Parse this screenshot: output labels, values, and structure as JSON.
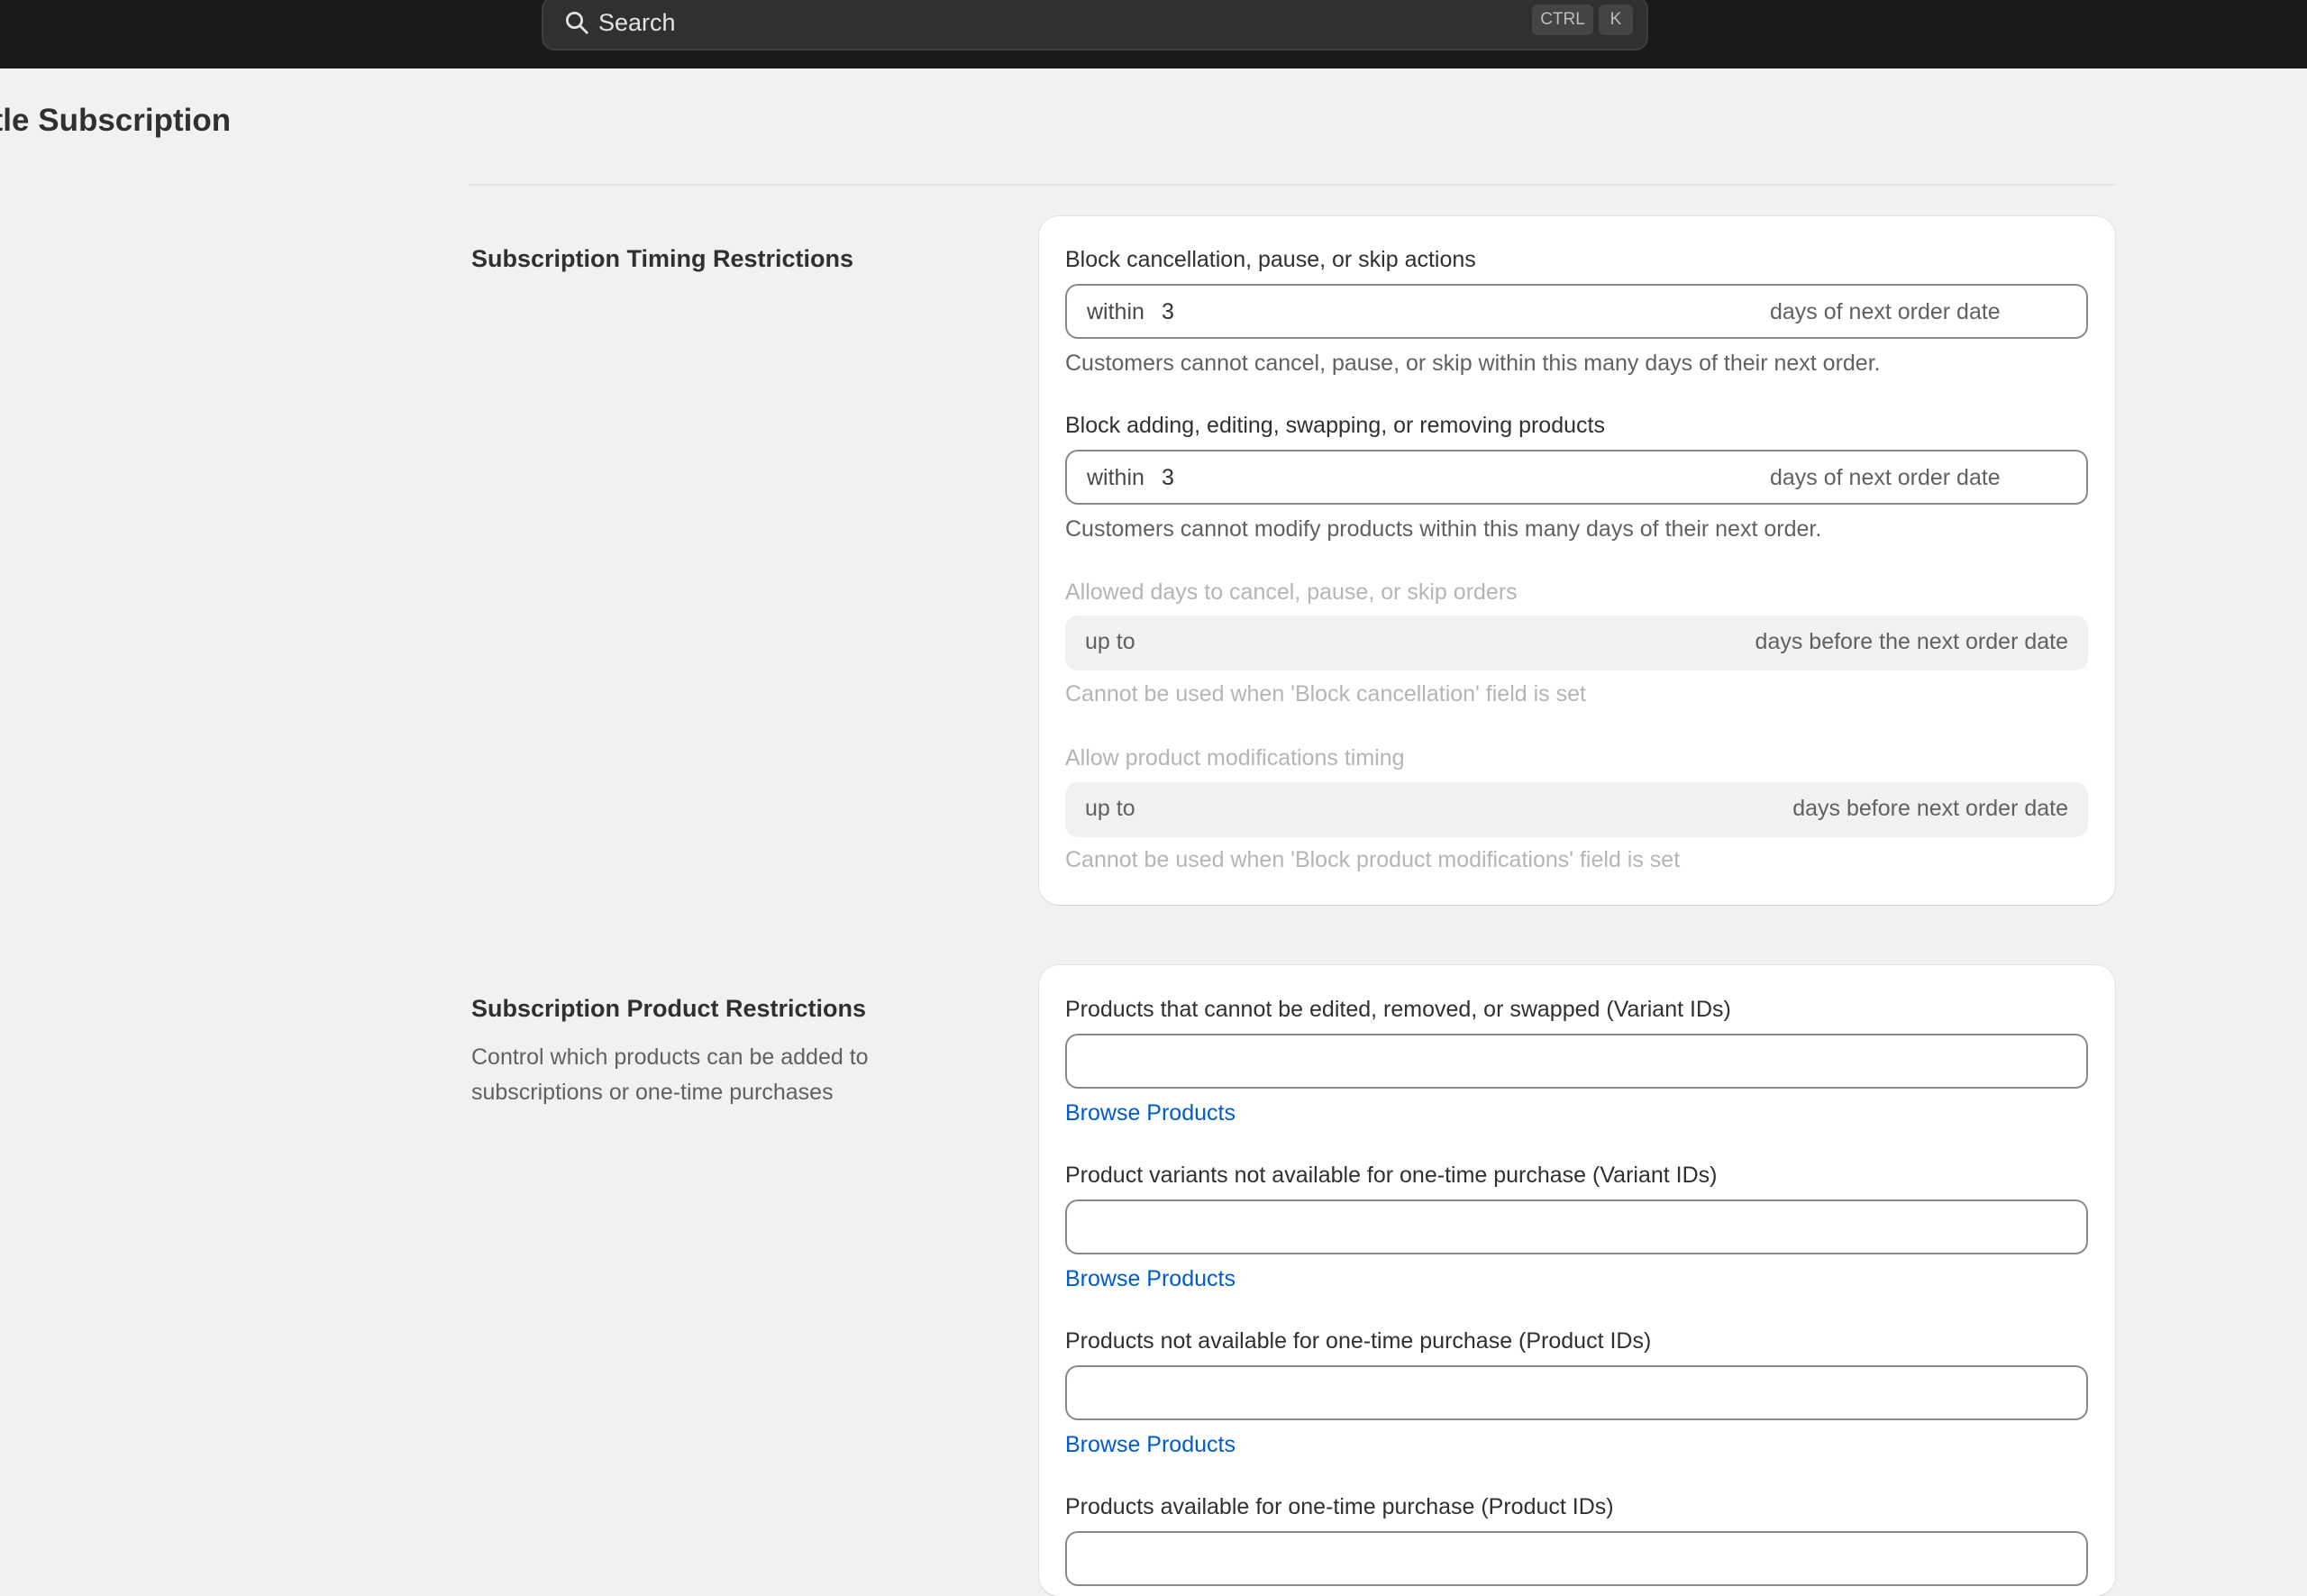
{
  "topbar": {
    "search": {
      "placeholder": "Search",
      "shortcut_keys": [
        "CTRL",
        "K"
      ],
      "icon": "search-icon"
    }
  },
  "page": {
    "title": "ttle Subscription"
  },
  "timing_section": {
    "title": "Subscription Timing Restrictions",
    "fields": [
      {
        "label": "Block cancellation, pause, or skip actions",
        "prefix": "within",
        "value": "3",
        "suffix": "days of next order date",
        "help": "Customers cannot cancel, pause, or skip within this many days of their next order.",
        "disabled": false
      },
      {
        "label": "Block adding, editing, swapping, or removing products",
        "prefix": "within",
        "value": "3",
        "suffix": "days of next order date",
        "help": "Customers cannot modify products within this many days of their next order.",
        "disabled": false
      },
      {
        "label": "Allowed days to cancel, pause, or skip orders",
        "prefix": "up to",
        "value": "",
        "suffix": "days before the next order date",
        "help": "Cannot be used when 'Block cancellation' field is set",
        "disabled": true
      },
      {
        "label": "Allow product modifications timing",
        "prefix": "up to",
        "value": "",
        "suffix": "days before next order date",
        "help": "Cannot be used when 'Block product modifications' field is set",
        "disabled": true
      }
    ]
  },
  "product_section": {
    "title": "Subscription Product Restrictions",
    "description": "Control which products can be added to subscriptions or one-time purchases",
    "fields": [
      {
        "label": "Products that cannot be edited, removed, or swapped (Variant IDs)",
        "value": "",
        "link": "Browse Products"
      },
      {
        "label": "Product variants not available for one-time purchase (Variant IDs)",
        "value": "",
        "link": "Browse Products"
      },
      {
        "label": "Products not available for one-time purchase (Product IDs)",
        "value": "",
        "link": "Browse Products"
      },
      {
        "label": "Products available for one-time purchase (Product IDs)",
        "value": ""
      }
    ]
  },
  "colors": {
    "topbar_bg": "#1a1a1a",
    "page_bg": "#f1f1f1",
    "link": "#005bd3",
    "disabled_text": "#b5b5b5"
  }
}
